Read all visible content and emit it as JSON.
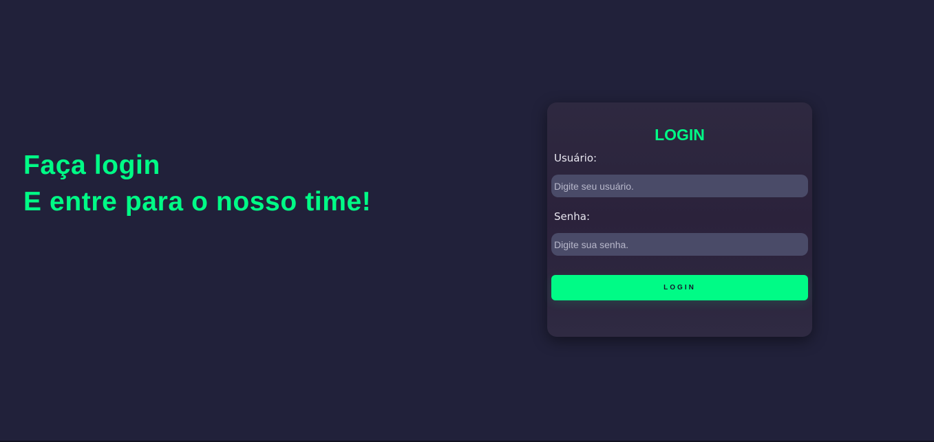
{
  "hero": {
    "line1": "Faça login",
    "line2": "E entre para o nosso time!"
  },
  "login_card": {
    "title": "LOGIN",
    "username": {
      "label": "Usuário:",
      "placeholder": "Digite seu usuário.",
      "value": ""
    },
    "password": {
      "label": "Senha:",
      "placeholder": "Digite sua senha.",
      "value": ""
    },
    "submit_label": "LOGIN"
  },
  "colors": {
    "background": "#21213a",
    "accent": "#00fb86",
    "card": "#2c2640",
    "input": "#4a4b68"
  }
}
